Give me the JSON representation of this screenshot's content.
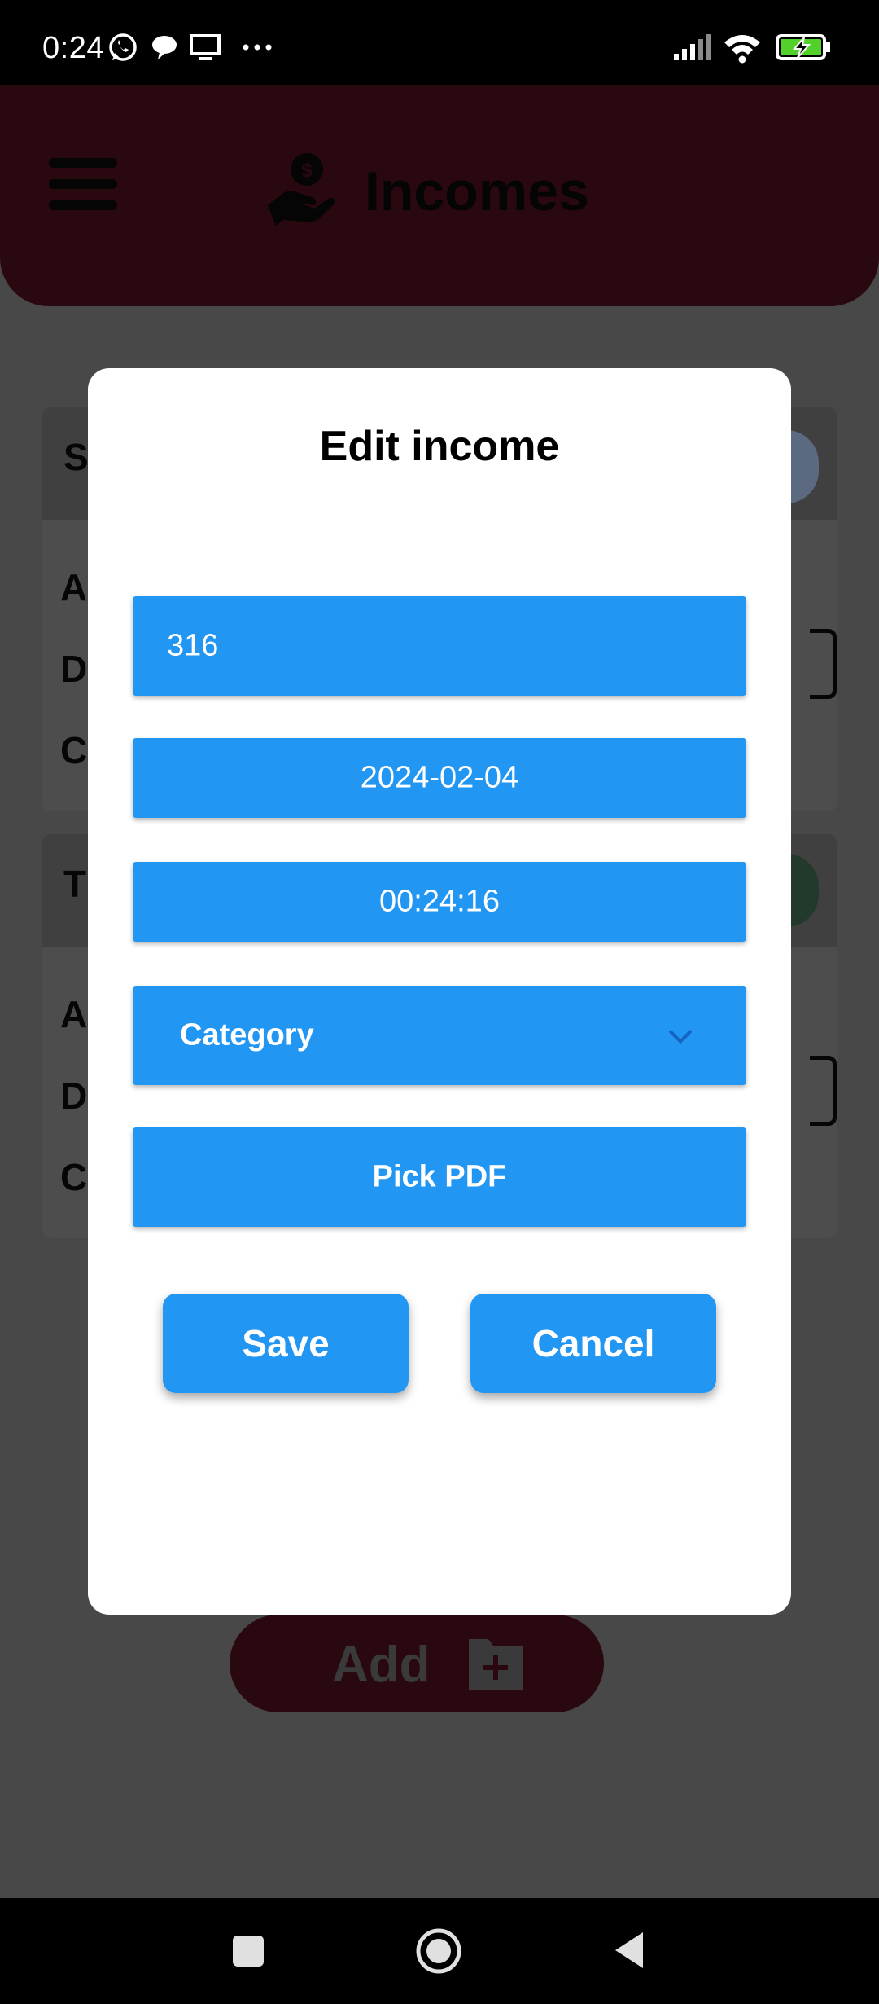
{
  "status_bar": {
    "time": "0:24",
    "icons": [
      "whatsapp-icon",
      "chat-bubble-icon",
      "screen-cast-icon",
      "more-dots-icon",
      "signal-icon",
      "wifi-icon",
      "battery-charging-icon"
    ]
  },
  "header": {
    "title": "Incomes",
    "menu_icon": "hamburger-menu-icon",
    "title_icon": "hand-coin-icon"
  },
  "background_cards": [
    {
      "title_initial": "S",
      "rows": [
        "A",
        "D",
        "C"
      ]
    },
    {
      "title_initial": "T",
      "rows": [
        "A",
        "D",
        "C"
      ]
    }
  ],
  "add_button": {
    "label": "Add",
    "icon": "folder-plus-icon"
  },
  "dialog": {
    "title": "Edit income",
    "amount_value": "316",
    "date_value": "2024-02-04",
    "time_value": "00:24:16",
    "category_label": "Category",
    "pdf_label": "Pick PDF",
    "save_label": "Save",
    "cancel_label": "Cancel"
  },
  "colors": {
    "accent": "#2196f3",
    "header_bg": "#2a0810",
    "overlay": "#484848"
  }
}
